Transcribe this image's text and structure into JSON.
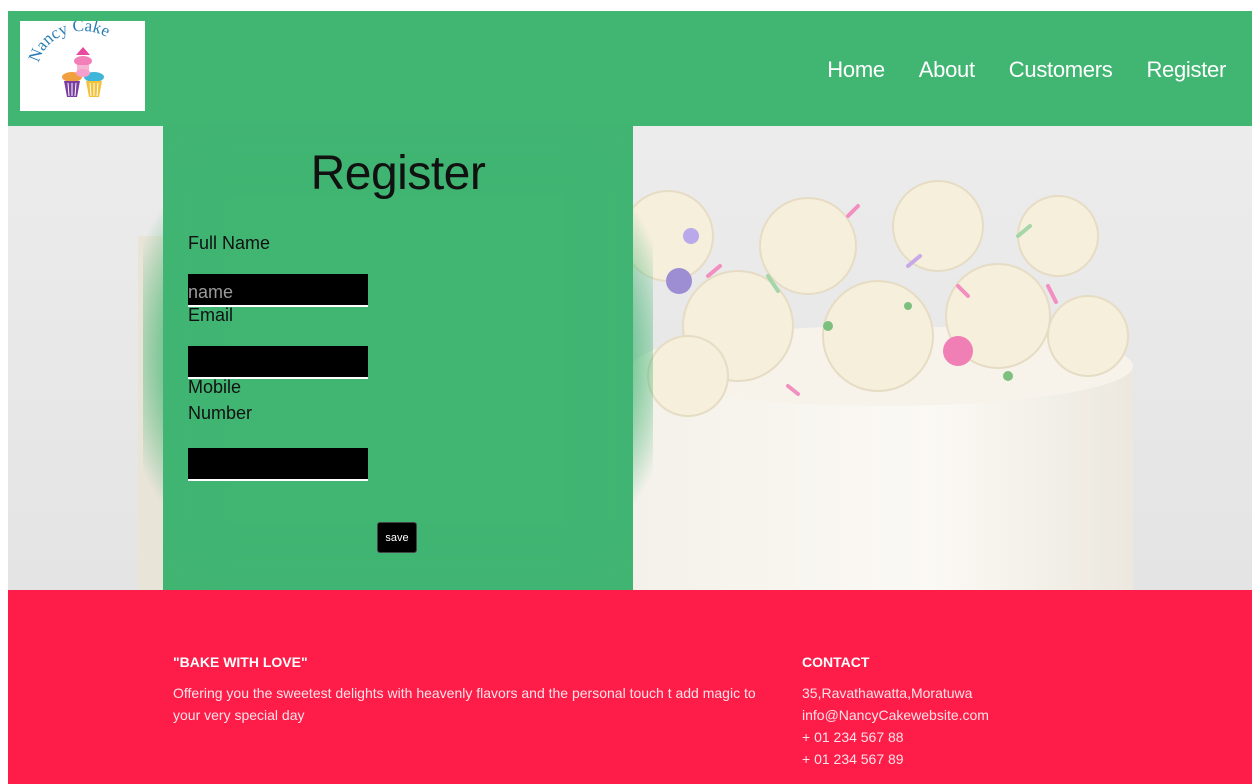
{
  "logo": {
    "text": "Nancy Cake"
  },
  "nav": {
    "items": [
      {
        "label": "Home"
      },
      {
        "label": "About"
      },
      {
        "label": "Customers"
      },
      {
        "label": "Register"
      }
    ]
  },
  "form": {
    "title": "Register",
    "full_name_label": "Full Name",
    "full_name_placeholder": "name",
    "email_label": "Email",
    "email_value": "",
    "mobile_label_line1": "Mobile",
    "mobile_label_line2": "Number",
    "mobile_value": "",
    "save_label": "save"
  },
  "footer": {
    "tagline_heading": "\"BAKE WITH LOVE\"",
    "tagline_text": "Offering you the sweetest delights with heavenly flavors and the personal touch t add magic to your very special day",
    "contact_heading": "CONTACT",
    "contact_lines": [
      "35,Ravathawatta,Moratuwa",
      "info@NancyCakewebsite.com",
      "+ 01 234 567 88",
      "+ 01 234 567 89"
    ]
  },
  "colors": {
    "nav_bg": "#41b572",
    "footer_bg": "#fe1c48",
    "form_bg": "#41b572"
  }
}
